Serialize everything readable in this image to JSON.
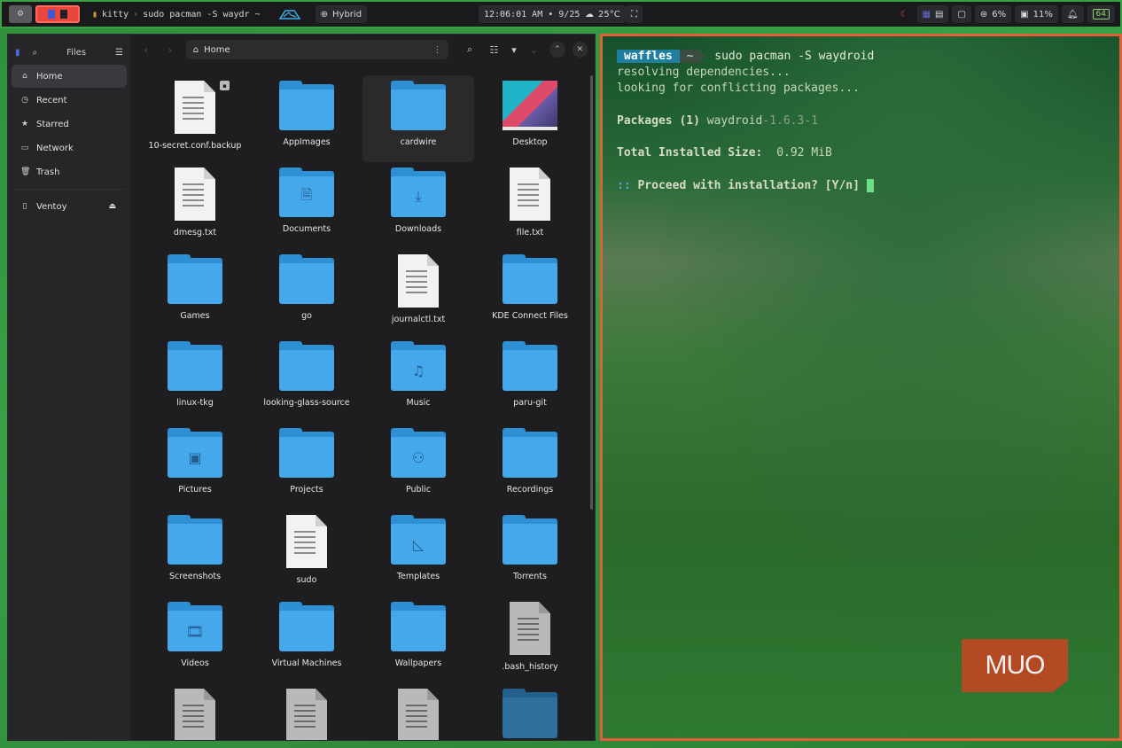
{
  "topbar": {
    "kitty_app": "kitty",
    "kitty_title": "sudo pacman -S waydr ~",
    "mode": "Hybrid",
    "clock": "12:06:01 AM • 9/25",
    "temperature": "25°C",
    "cpu": "6%",
    "memory": "11%",
    "battery": "64"
  },
  "sidebar": {
    "title": "Files",
    "items": [
      {
        "label": "Home",
        "icon": "home-icon",
        "active": true
      },
      {
        "label": "Recent",
        "icon": "clock-icon"
      },
      {
        "label": "Starred",
        "icon": "star-icon"
      },
      {
        "label": "Network",
        "icon": "network-icon"
      },
      {
        "label": "Trash",
        "icon": "trash-icon"
      }
    ],
    "devices": [
      {
        "label": "Ventoy",
        "icon": "usb-drive-icon"
      }
    ]
  },
  "toolbar": {
    "path": "Home"
  },
  "files": [
    {
      "name": "10-secret.conf.backup",
      "kind": "doc",
      "badge": "lock"
    },
    {
      "name": "AppImages",
      "kind": "folder"
    },
    {
      "name": "cardwire",
      "kind": "folder",
      "hover": true
    },
    {
      "name": "Desktop",
      "kind": "thumb"
    },
    {
      "name": "dmesg.txt",
      "kind": "doc"
    },
    {
      "name": "Documents",
      "kind": "folder",
      "glyph": "🗎"
    },
    {
      "name": "Downloads",
      "kind": "folder",
      "glyph": "⤓"
    },
    {
      "name": "file.txt",
      "kind": "doc"
    },
    {
      "name": "Games",
      "kind": "folder"
    },
    {
      "name": "go",
      "kind": "folder"
    },
    {
      "name": "journalctl.txt",
      "kind": "doc"
    },
    {
      "name": "KDE Connect Files",
      "kind": "folder"
    },
    {
      "name": "linux-tkg",
      "kind": "folder"
    },
    {
      "name": "looking-glass-source",
      "kind": "folder"
    },
    {
      "name": "Music",
      "kind": "folder",
      "glyph": "♫"
    },
    {
      "name": "paru-git",
      "kind": "folder"
    },
    {
      "name": "Pictures",
      "kind": "folder",
      "glyph": "▣"
    },
    {
      "name": "Projects",
      "kind": "folder"
    },
    {
      "name": "Public",
      "kind": "folder",
      "glyph": "⚇"
    },
    {
      "name": "Recordings",
      "kind": "folder"
    },
    {
      "name": "Screenshots",
      "kind": "folder"
    },
    {
      "name": "sudo",
      "kind": "doc"
    },
    {
      "name": "Templates",
      "kind": "folder",
      "glyph": "◺"
    },
    {
      "name": "Torrents",
      "kind": "folder"
    },
    {
      "name": "Videos",
      "kind": "folder",
      "glyph": "🎞"
    },
    {
      "name": "Virtual Machines",
      "kind": "folder"
    },
    {
      "name": "Wallpapers",
      "kind": "folder"
    },
    {
      "name": ".bash_history",
      "kind": "doc-gray"
    },
    {
      "name": "",
      "kind": "doc-gray"
    },
    {
      "name": "",
      "kind": "doc-gray"
    },
    {
      "name": "",
      "kind": "doc-gray"
    },
    {
      "name": "",
      "kind": "folder-dim"
    }
  ],
  "terminal": {
    "prompt_user": "waffles",
    "prompt_dir": "~",
    "command": "sudo pacman -S waydroid",
    "line1": "resolving dependencies...",
    "line2": "looking for conflicting packages...",
    "packages_label": "Packages (1)",
    "package_name": "waydroid",
    "package_version": "-1.6.3-1",
    "size_label": "Total Installed Size:",
    "size_value": "0.92 MiB",
    "proceed_prefix": "::",
    "proceed_text": "Proceed with installation? [Y/n]"
  },
  "watermark": "MUO"
}
